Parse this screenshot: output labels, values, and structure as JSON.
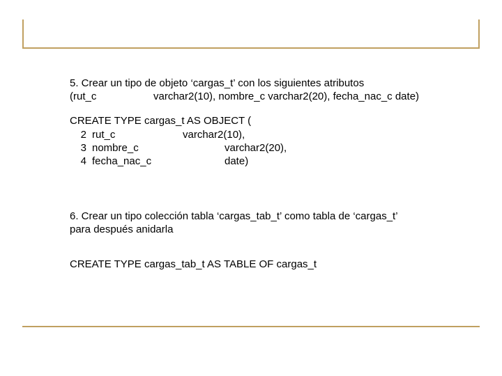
{
  "slide": {
    "q5": {
      "line1": "5. Crear un tipo de objeto ‘cargas_t’ con los siguientes atributos",
      "line2a": "(rut_c",
      "line2b": "varchar2(10), nombre_c varchar2(20), fecha_nac_c date)"
    },
    "code5": {
      "head": "CREATE TYPE cargas_t AS OBJECT (",
      "l2n": "2",
      "l2a": "rut_c",
      "l2b": "varchar2(10),",
      "l3n": "3",
      "l3a": "nombre_c",
      "l3b": "varchar2(20),",
      "l4n": "4",
      "l4a": "fecha_nac_c",
      "l4b": "date)"
    },
    "q6": {
      "line1": "6. Crear un tipo colección tabla  ‘cargas_tab_t’ como tabla de ‘cargas_t’",
      "line2": "para después anidarla"
    },
    "code6": {
      "line": "CREATE TYPE cargas_tab_t AS TABLE OF cargas_t"
    }
  }
}
